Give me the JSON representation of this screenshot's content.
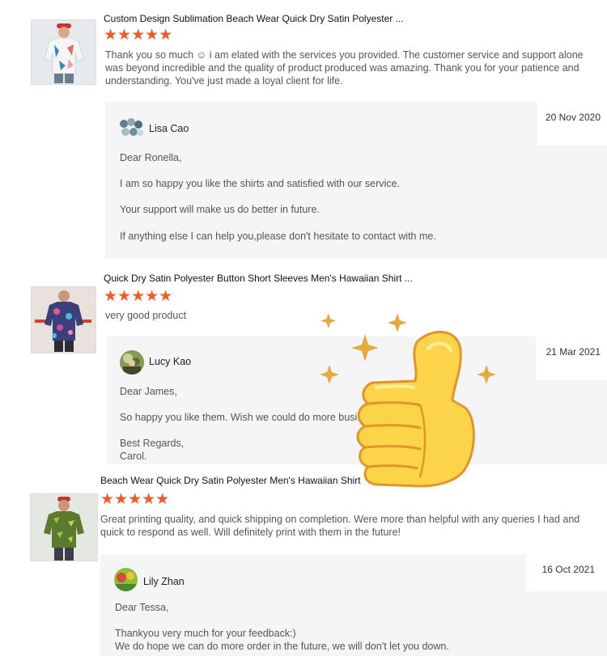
{
  "colors": {
    "star": "#f05a24",
    "reply_bg": "#f5f5f7",
    "thumbs_fill": "#fbd44a",
    "sparkle": "#e8a93c"
  },
  "reviews": [
    {
      "product_title": "Custom Design Sublimation Beach Wear Quick Dry Satin Polyester ...",
      "rating": 5,
      "stars": "★★★★★",
      "text_lines": [
        "Thank you so much ☺ i am elated with the services you provided. The customer service and support alone",
        "was beyond incredible and the quality of product produced was amazing. Thank you for your patience and",
        "understanding. You've just made a loyal client for life."
      ],
      "reply": {
        "date": "20 Nov 2020",
        "name": "Lisa Cao",
        "lines": [
          "Dear Ronella,",
          "I am so happy you like the shirts and satisfied with our service.",
          "Your support will make us do better in future.",
          "If anything else I can help you,please don't hesitate to contact with me."
        ]
      }
    },
    {
      "product_title": "Quick Dry Satin Polyester Button Short Sleeves Men's Hawaiian Shirt ...",
      "rating": 5,
      "stars": "★★★★★",
      "text_lines": [
        "very good product"
      ],
      "reply": {
        "date": "21 Mar 2021",
        "name": "Lucy Kao",
        "lines": [
          "Dear James,",
          "So happy you like them. Wish we could do more busi",
          "Best Regards,",
          "Carol."
        ]
      }
    },
    {
      "product_title": "Beach Wear Quick Dry Satin Polyester Men's Hawaiian Shirt",
      "rating": 5,
      "stars": "★★★★★",
      "text_lines": [
        "Great printing quality, and quick shipping on completion. Were more than helpful with any queries I had and",
        "quick to respond as well. Will definitely print with them in the future!"
      ],
      "reply": {
        "date": "16 Oct 2021",
        "name": "Lily Zhan",
        "lines": [
          "Dear Tessa,",
          "Thankyou very much for your feedback:)",
          "We do hope we can do more order in the future, we will don't let you down."
        ]
      }
    }
  ],
  "icons": {
    "overlay": "thumbs-up-icon",
    "sparkles": "sparkle-icon"
  }
}
